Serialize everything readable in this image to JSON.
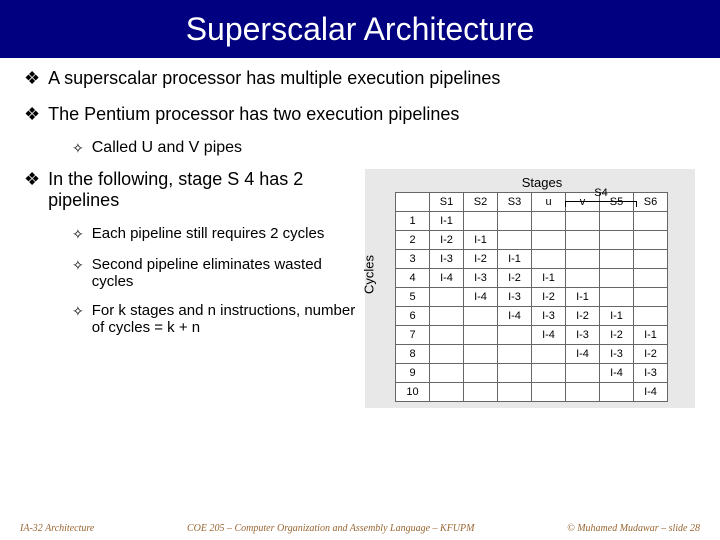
{
  "title": "Superscalar Architecture",
  "bullets_top": [
    "A superscalar processor has multiple execution pipelines",
    "The Pentium processor has two execution pipelines"
  ],
  "sub_top": "Called U and V pipes",
  "bullet_left": "In the following, stage S 4 has 2 pipelines",
  "subs_left": [
    "Each pipeline still requires 2 cycles",
    "Second pipeline eliminates wasted cycles",
    "For k stages and n instructions, number of cycles = k + n"
  ],
  "diagram": {
    "stages_label": "Stages",
    "cycles_label": "Cycles",
    "s4_label": "S4",
    "headers": [
      "",
      "S1",
      "S2",
      "S3",
      "u",
      "v",
      "S5",
      "S6"
    ],
    "rows": [
      [
        "1",
        "I-1",
        "",
        "",
        "",
        "",
        "",
        ""
      ],
      [
        "2",
        "I-2",
        "I-1",
        "",
        "",
        "",
        "",
        ""
      ],
      [
        "3",
        "I-3",
        "I-2",
        "I-1",
        "",
        "",
        "",
        ""
      ],
      [
        "4",
        "I-4",
        "I-3",
        "I-2",
        "I-1",
        "",
        "",
        ""
      ],
      [
        "5",
        "",
        "I-4",
        "I-3",
        "I-2",
        "I-1",
        "",
        ""
      ],
      [
        "6",
        "",
        "",
        "I-4",
        "I-3",
        "I-2",
        "I-1",
        ""
      ],
      [
        "7",
        "",
        "",
        "",
        "I-4",
        "I-3",
        "I-2",
        "I-1"
      ],
      [
        "8",
        "",
        "",
        "",
        "",
        "I-4",
        "I-3",
        "I-2"
      ],
      [
        "9",
        "",
        "",
        "",
        "",
        "",
        "I-4",
        "I-3"
      ],
      [
        "10",
        "",
        "",
        "",
        "",
        "",
        "",
        "I-4"
      ]
    ]
  },
  "footer": {
    "left": "IA-32 Architecture",
    "center": "COE 205 – Computer Organization and Assembly Language – KFUPM",
    "right": "© Muhamed Mudawar – slide 28"
  }
}
